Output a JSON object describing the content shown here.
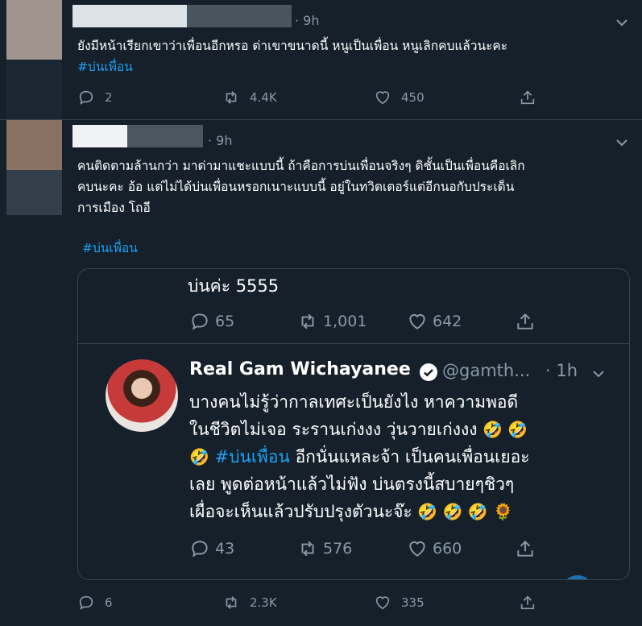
{
  "tweet1": {
    "time": "· 9h",
    "text": "ยังมีหน้าเรียกเขาว่าเพื่อนอีกหรอ ด่าเขาขนาดนี้ หนูเป็นเพื่อน หนูเลิกคบแล้วนะคะ",
    "hashtag": "#บ่นเพื่อน",
    "replies": "2",
    "retweets": "4.4K",
    "likes": "450"
  },
  "tweet2": {
    "time": "· 9h",
    "line1": "คนติดตามล้านกว่า มาด่ามาแชะแบบนี้ ถ้าคือการบ่นเพื่อนจริงๆ ดิชั้นเป็นเพื่อนคือเลิก",
    "line2": "คบนะคะ อ้อ แต่ไม่ได้บ่นเพื่อนหรอกเนาะแบบนี้ อยู่ในทวิตเตอร์แต่อีกนอกับประเด็น",
    "line3": "การเมือง โถอี",
    "hashtag": "#บ่นเพื่อน",
    "replies": "6",
    "retweets": "2.3K",
    "likes": "335"
  },
  "quote": {
    "top_text": "บ่นค่ะ 5555",
    "top_replies": "65",
    "top_retweets": "1,001",
    "top_likes": "642",
    "name": "Real Gam Wichayanee",
    "handle": "@gamth...",
    "time": "· 1h",
    "line1": "บางคนไม่รู้ว่ากาลเทศะเป็นยังไง หาความพอดี",
    "line2a": "ในชีวิตไม่เจอ ระรานเก่งงง วุ่นวายเก่งงง",
    "line2_emoji": "🤣 🤣",
    "line3_emoji": "🤣",
    "line3_hashtag": "#บ่นเพื่อน",
    "line3b": "อีกนั่นแหละจ้า เป็นคนเพื่อนเยอะ",
    "line4": "เลย พูดต่อหน้าแล้วไม่ฟัง บ่นตรงนี้สบายๆชิวๆ",
    "line5": "เผื่อจะเห็นแล้วปรับปรุงตัวนะจ๊ะ",
    "line5_emoji": "🤣 🤣 🤣 🌻",
    "replies": "43",
    "retweets": "576",
    "likes": "660"
  },
  "colors": {
    "background": "#15202b",
    "muted": "#8899a6",
    "accent": "#1da1f2",
    "border": "#38444d"
  }
}
